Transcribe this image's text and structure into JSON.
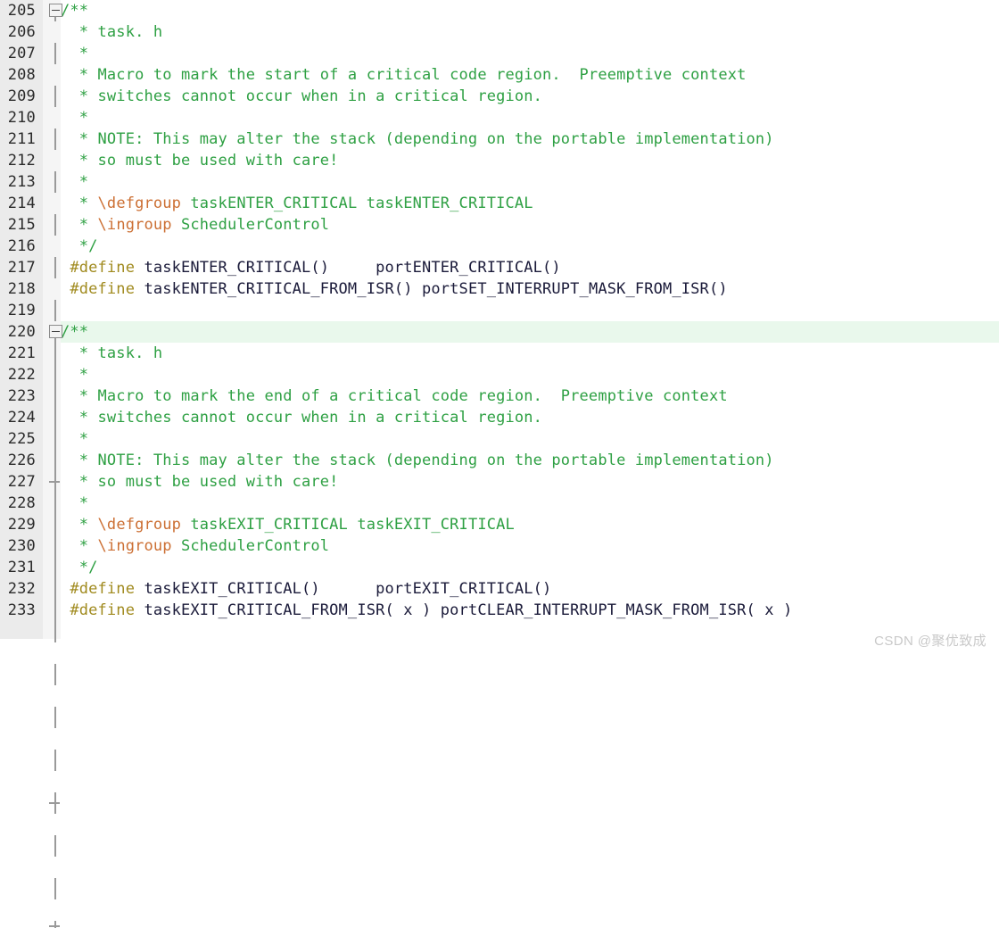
{
  "editor": {
    "language": "c",
    "file_hint": "task.h",
    "colors": {
      "background": "#ffffff",
      "gutter": "#ebebeb",
      "gutter_strip": "#f5f5f5",
      "line_number": "#2b2b2b",
      "comment": "#2ea043",
      "doxygen_tag": "#cc6f33",
      "preprocessor": "#a08a1e",
      "identifier": "#1b1b3a",
      "current_line_highlight": "#e9f8ec",
      "fold_marker": "#9a9a9a",
      "watermark": "#c9c9c9"
    },
    "line_height_px": 24,
    "font_size_px": 17
  },
  "blocks": [
    {
      "name": "taskENTER_CRITICAL-block",
      "fold_open_line": "205",
      "fold_close_line": "216",
      "lines": [
        {
          "no": "205",
          "fold": "open",
          "highlight": false,
          "segments": [
            {
              "cls": "cmt",
              "text": "/**"
            }
          ]
        },
        {
          "no": "206",
          "fold": "bar",
          "highlight": false,
          "segments": [
            {
              "cls": "cmt",
              "text": "  * task. h"
            }
          ]
        },
        {
          "no": "207",
          "fold": "bar",
          "highlight": false,
          "segments": [
            {
              "cls": "cmt",
              "text": "  *"
            }
          ]
        },
        {
          "no": "208",
          "fold": "bar",
          "highlight": false,
          "segments": [
            {
              "cls": "cmt",
              "text": "  * Macro to mark the start of a critical code region.  Preemptive context"
            }
          ]
        },
        {
          "no": "209",
          "fold": "bar",
          "highlight": false,
          "segments": [
            {
              "cls": "cmt",
              "text": "  * switches cannot occur when in a critical region."
            }
          ]
        },
        {
          "no": "210",
          "fold": "bar",
          "highlight": false,
          "segments": [
            {
              "cls": "cmt",
              "text": "  *"
            }
          ]
        },
        {
          "no": "211",
          "fold": "bar",
          "highlight": false,
          "segments": [
            {
              "cls": "cmt",
              "text": "  * NOTE: This may alter the stack (depending on the portable implementation)"
            }
          ]
        },
        {
          "no": "212",
          "fold": "bar",
          "highlight": false,
          "segments": [
            {
              "cls": "cmt",
              "text": "  * so must be used with care!"
            }
          ]
        },
        {
          "no": "213",
          "fold": "bar",
          "highlight": false,
          "segments": [
            {
              "cls": "cmt",
              "text": "  *"
            }
          ]
        },
        {
          "no": "214",
          "fold": "bar",
          "highlight": false,
          "segments": [
            {
              "cls": "cmt",
              "text": "  * "
            },
            {
              "cls": "doxtag",
              "text": "\\defgroup"
            },
            {
              "cls": "cmt",
              "text": " taskENTER_CRITICAL taskENTER_CRITICAL"
            }
          ]
        },
        {
          "no": "215",
          "fold": "bar",
          "highlight": false,
          "segments": [
            {
              "cls": "cmt",
              "text": "  * "
            },
            {
              "cls": "doxtag",
              "text": "\\ingroup"
            },
            {
              "cls": "cmt",
              "text": " SchedulerControl"
            }
          ]
        },
        {
          "no": "216",
          "fold": "end",
          "highlight": false,
          "segments": [
            {
              "cls": "cmt",
              "text": "  */"
            }
          ]
        },
        {
          "no": "217",
          "fold": "bar",
          "highlight": false,
          "segments": [
            {
              "cls": "pp",
              "text": " #define "
            },
            {
              "cls": "ident",
              "text": "taskENTER_CRITICAL()     portENTER_CRITICAL()"
            }
          ]
        },
        {
          "no": "218",
          "fold": "bar",
          "highlight": false,
          "segments": [
            {
              "cls": "pp",
              "text": " #define "
            },
            {
              "cls": "ident",
              "text": "taskENTER_CRITICAL_FROM_ISR() portSET_INTERRUPT_MASK_FROM_ISR()"
            }
          ]
        },
        {
          "no": "219",
          "fold": "bar",
          "highlight": false,
          "segments": [
            {
              "cls": "cmt",
              "text": ""
            }
          ]
        }
      ]
    },
    {
      "name": "taskEXIT_CRITICAL-block",
      "fold_open_line": "220",
      "fold_close_line": "231",
      "lines": [
        {
          "no": "220",
          "fold": "open",
          "highlight": true,
          "segments": [
            {
              "cls": "cmt",
              "text": "/**"
            }
          ]
        },
        {
          "no": "221",
          "fold": "bar",
          "highlight": false,
          "segments": [
            {
              "cls": "cmt",
              "text": "  * task. h"
            }
          ]
        },
        {
          "no": "222",
          "fold": "bar",
          "highlight": false,
          "segments": [
            {
              "cls": "cmt",
              "text": "  *"
            }
          ]
        },
        {
          "no": "223",
          "fold": "bar",
          "highlight": false,
          "segments": [
            {
              "cls": "cmt",
              "text": "  * Macro to mark the end of a critical code region.  Preemptive context"
            }
          ]
        },
        {
          "no": "224",
          "fold": "bar",
          "highlight": false,
          "segments": [
            {
              "cls": "cmt",
              "text": "  * switches cannot occur when in a critical region."
            }
          ]
        },
        {
          "no": "225",
          "fold": "bar",
          "highlight": false,
          "segments": [
            {
              "cls": "cmt",
              "text": "  *"
            }
          ]
        },
        {
          "no": "226",
          "fold": "bar",
          "highlight": false,
          "segments": [
            {
              "cls": "cmt",
              "text": "  * NOTE: This may alter the stack (depending on the portable implementation)"
            }
          ]
        },
        {
          "no": "227",
          "fold": "bar",
          "highlight": false,
          "segments": [
            {
              "cls": "cmt",
              "text": "  * so must be used with care!"
            }
          ]
        },
        {
          "no": "228",
          "fold": "bar",
          "highlight": false,
          "segments": [
            {
              "cls": "cmt",
              "text": "  *"
            }
          ]
        },
        {
          "no": "229",
          "fold": "bar",
          "highlight": false,
          "segments": [
            {
              "cls": "cmt",
              "text": "  * "
            },
            {
              "cls": "doxtag",
              "text": "\\defgroup"
            },
            {
              "cls": "cmt",
              "text": " taskEXIT_CRITICAL taskEXIT_CRITICAL"
            }
          ]
        },
        {
          "no": "230",
          "fold": "bar",
          "highlight": false,
          "segments": [
            {
              "cls": "cmt",
              "text": "  * "
            },
            {
              "cls": "doxtag",
              "text": "\\ingroup"
            },
            {
              "cls": "cmt",
              "text": " SchedulerControl"
            }
          ]
        },
        {
          "no": "231",
          "fold": "end",
          "highlight": false,
          "segments": [
            {
              "cls": "cmt",
              "text": "  */"
            }
          ]
        },
        {
          "no": "232",
          "fold": "bar",
          "highlight": false,
          "segments": [
            {
              "cls": "pp",
              "text": " #define "
            },
            {
              "cls": "ident",
              "text": "taskEXIT_CRITICAL()      portEXIT_CRITICAL()"
            }
          ]
        },
        {
          "no": "233",
          "fold": "bar",
          "highlight": false,
          "segments": [
            {
              "cls": "pp",
              "text": " #define "
            },
            {
              "cls": "ident",
              "text": "taskEXIT_CRITICAL_FROM_ISR( x ) portCLEAR_INTERRUPT_MASK_FROM_ISR( x )"
            }
          ]
        },
        {
          "no": "",
          "fold": "endcap",
          "highlight": false,
          "partial": true,
          "segments": [
            {
              "cls": "cmt",
              "text": ""
            }
          ]
        }
      ]
    }
  ],
  "watermark": {
    "text": "CSDN @聚优致成"
  }
}
